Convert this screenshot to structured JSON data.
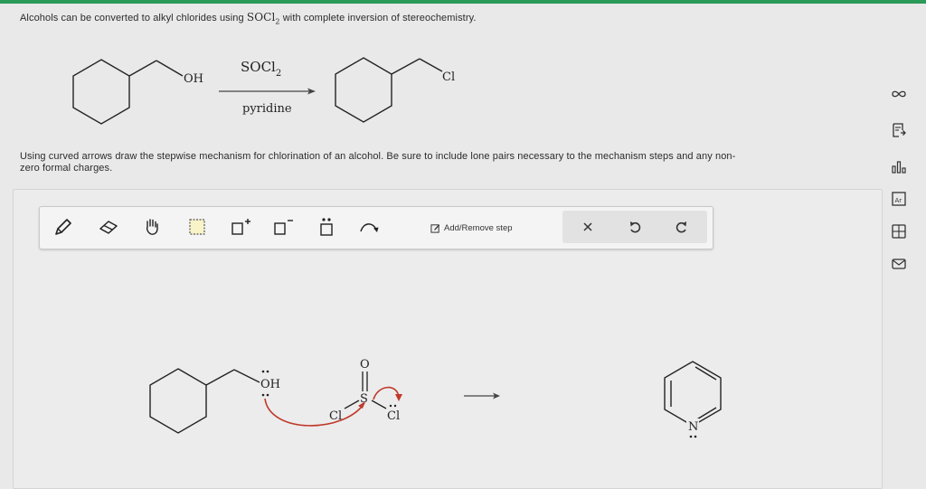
{
  "question": {
    "intro_before": "Alcohols can be converted to alkyl chlorides using ",
    "reagent_main": "SOCl",
    "reagent_sub": "2",
    "intro_after": " with complete inversion of stereochemistry.",
    "instructions_line1": "Using curved arrows draw the stepwise mechanism for chlorination of an alcohol. Be sure to include lone pairs necessary to the mechanism steps and any non-",
    "instructions_line2": "zero formal charges."
  },
  "reaction": {
    "reactant_group": "OH",
    "reagent_main": "SOCl",
    "reagent_sub": "2",
    "conditions": "pyridine",
    "product_group": "Cl"
  },
  "toolbar": {
    "add_remove_label": "Add/Remove step"
  },
  "canvas": {
    "oh_label": "OH",
    "s_label": "S",
    "o_label": "O",
    "cl_left_label": "Cl",
    "cl_right_label": "Cl",
    "n_label": "N"
  },
  "colors": {
    "accent_green": "#2a9a58",
    "arrow_red": "#c0392b"
  }
}
